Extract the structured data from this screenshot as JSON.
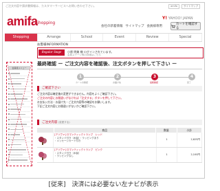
{
  "header": {
    "notice": "ご注文内容や請求書情報は、カスタマーサービスへお問い合わせ下さい。",
    "top_links": [
      "amifa",
      "サイトマップ"
    ],
    "logo": "amifa",
    "logo_sub": "Shopping",
    "yahoo_prefix": "Y!",
    "yahoo_text": "YAHOO! JAPAN",
    "util_links": [
      "会社の新着情報",
      "サイトマップ",
      "会員様専用"
    ],
    "cart_label": "カートを確認する",
    "cart_icon": "cart-icon"
  },
  "nav": {
    "items": [
      "Shopping",
      "Arrange",
      "School",
      "Event",
      "Review",
      "Special"
    ],
    "active": "Shopping"
  },
  "member": {
    "section_label": "お客様INFORMATION",
    "badge": "Regular Stage",
    "text": "小原 明美 様 ログインされています。",
    "sub": "会員ステージ等の詳細はこちら"
  },
  "page": {
    "title": "最終確認 ー ご注文内容を確認後、注文ボタンを押して下さい ー"
  },
  "steps": [
    {
      "num": "1",
      "label": "カートの確認"
    },
    {
      "num": "2",
      "label": "お届け先"
    },
    {
      "num": "3",
      "label": "最終確認"
    },
    {
      "num": "4",
      "label": "完了"
    }
  ],
  "active_step": 2,
  "sidebar": {
    "label": "左ナビ",
    "head": "会員様メニュー",
    "item_count": 18
  },
  "warning": {
    "title": "ご確認下さい",
    "lines": [
      "ご注文内容は確定後の変更ができません。内容をよくご確認下さい。",
      "ご注文の内容にお間違いがなければ「注文する」ボタンを押して下さい。",
      "お支払い方法・お届け先・ご注文内容等の確認をお願いします。",
      "下記ご注文内容にお間違いがないかご確認下さい。"
    ]
  },
  "order": {
    "section_title": "ご注文内容",
    "section_sub": "(変更する)",
    "headers": [
      "",
      "商品",
      "数量",
      "小計"
    ],
    "rows": [
      {
        "name": "[アリヴァ] ロマンティックトランプ　レッド",
        "sub1": "・スタンド付き（木製）・ラッピングあり",
        "sub2": "・メッセージカード付き",
        "qty": "1",
        "price": "2,625円",
        "thumb_color": "#a0324a"
      },
      {
        "name": "[アリヴァ] ロマンティックトランプ　ピンク",
        "sub1": "・スタンド付き（木製）",
        "sub2": "・ラッピングなし",
        "qty": "1",
        "price": "2,100円",
        "thumb_color": "#b84a6a"
      }
    ]
  },
  "caption": "[従来]　決済には必要ない左ナビが表示",
  "colors": {
    "brand": "#c8102e",
    "nav_active": "#d9334b"
  }
}
